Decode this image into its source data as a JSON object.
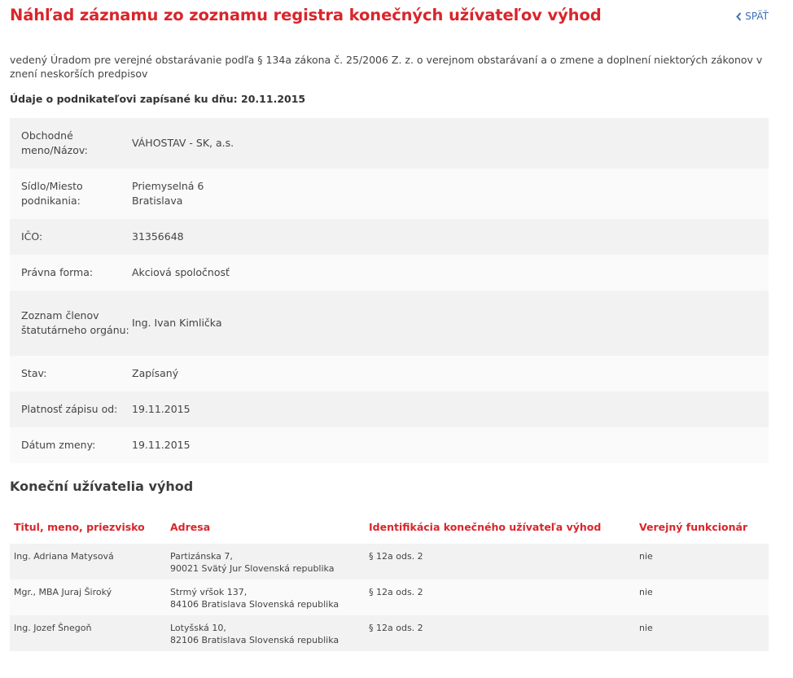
{
  "header": {
    "title": "Náhľad záznamu zo zoznamu registra konečných užívateľov výhod",
    "back_label": "SPÄŤ"
  },
  "subtitle": "vedený Úradom pre verejné obstarávanie podľa § 134a zákona č. 25/2006 Z. z. o verejnom obstarávaní a o zmene a doplnení niektorých zákonov v znení neskorších predpisov",
  "recorded_label": "Údaje o podnikateľovi zapísané ku dňu: 20.11.2015",
  "details": {
    "name_label": "Obchodné meno/Názov:",
    "name_value": "VÁHOSTAV - SK, a.s.",
    "seat_label": "Sídlo/Miesto podnikania:",
    "seat_street": "Priemyselná 6",
    "seat_city": "Bratislava",
    "ico_label": "IČO:",
    "ico_value": "31356648",
    "form_label": "Právna forma:",
    "form_value": "Akciová spoločnosť",
    "members_label": "Zoznam členov štatutárneho orgánu:",
    "members_value": "Ing. Ivan Kimlička",
    "status_label": "Stav:",
    "status_value": "Zapísaný",
    "valid_label": "Platnosť zápisu od:",
    "valid_value": "19.11.2015",
    "changed_label": "Dátum zmeny:",
    "changed_value": "19.11.2015"
  },
  "beneficiaries": {
    "title": "Koneční užívatelia výhod",
    "headers": [
      "Titul, meno, priezvisko",
      "Adresa",
      "Identifikácia konečného užívateľa výhod",
      "Verejný funkcionár"
    ],
    "rows": [
      {
        "name": "Ing. Adriana Matysová",
        "address_line1": "Partizánska 7,",
        "address_line2": "90021 Svätý Jur Slovenská republika",
        "identification": "§ 12a ods. 2",
        "official": "nie"
      },
      {
        "name": "Mgr., MBA Juraj Široký",
        "address_line1": "Strmý vŕšok 137,",
        "address_line2": "84106 Bratislava Slovenská republika",
        "identification": "§ 12a ods. 2",
        "official": "nie"
      },
      {
        "name": "Ing. Jozef Šnegoň",
        "address_line1": "Lotyšská 10,",
        "address_line2": "82106 Bratislava Slovenská republika",
        "identification": "§ 12a ods. 2",
        "official": "nie"
      }
    ]
  }
}
